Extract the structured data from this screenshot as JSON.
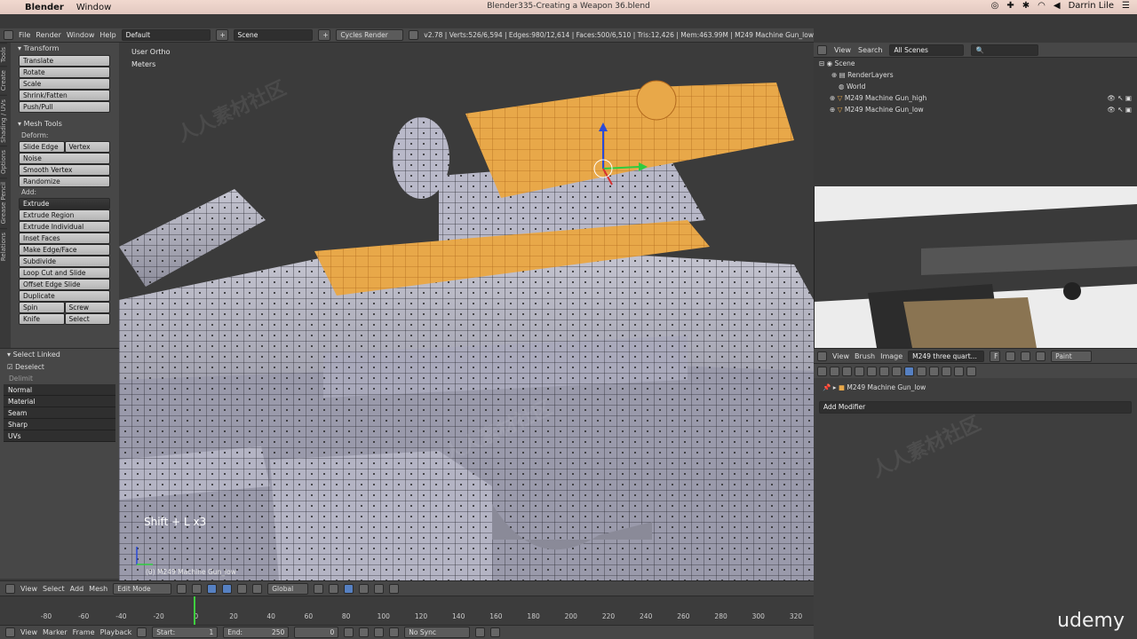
{
  "mac": {
    "apple": "",
    "app": "Blender",
    "window": "Window",
    "title": "Blender335-Creating a Weapon 36.blend",
    "user": "Darrin Lile"
  },
  "info": {
    "menus": [
      "File",
      "Render",
      "Window",
      "Help"
    ],
    "layout": "Default",
    "scene": "Scene",
    "engine": "Cycles Render",
    "stats": "v2.78 | Verts:526/6,594 | Edges:980/12,614 | Faces:500/6,510 | Tris:12,426 | Mem:463.99M | M249 Machine Gun_low"
  },
  "tabs": [
    "Tools",
    "Create",
    "Shading / UVs",
    "Options",
    "Grease Pencil",
    "Relations"
  ],
  "shelf": {
    "transform_title": "Transform",
    "transform": [
      "Translate",
      "Rotate",
      "Scale",
      "Shrink/Fatten",
      "Push/Pull"
    ],
    "mesh_title": "Mesh Tools",
    "deform_label": "Deform:",
    "slide_edge": "Slide Edge",
    "vertex": "Vertex",
    "deform": [
      "Noise",
      "Smooth Vertex",
      "Randomize"
    ],
    "add_label": "Add:",
    "extrude": "Extrude",
    "add": [
      "Extrude Region",
      "Extrude Individual",
      "Inset Faces",
      "Make Edge/Face",
      "Subdivide",
      "Loop Cut and Slide",
      "Offset Edge Slide",
      "Duplicate"
    ],
    "spin": "Spin",
    "screw": "Screw",
    "knife": "Knife",
    "select": "Select"
  },
  "redo": {
    "title": "Select Linked",
    "deselect": "Deselect",
    "delimit": "Delimit",
    "options": [
      "Normal",
      "Material",
      "Seam",
      "Sharp",
      "UVs"
    ]
  },
  "viewport": {
    "view": "User Ortho",
    "units": "Meters",
    "keys": "Shift + L x3",
    "object": "(0) M249 Machine Gun_low",
    "watermark": "人人素材社区"
  },
  "v3dh": {
    "menus": [
      "View",
      "Select",
      "Add",
      "Mesh"
    ],
    "mode": "Edit Mode",
    "orient": "Global"
  },
  "timeline": {
    "ticks": [
      "-80",
      "-60",
      "-40",
      "-20",
      "0",
      "20",
      "40",
      "60",
      "80",
      "100",
      "120",
      "140",
      "160",
      "180",
      "200",
      "220",
      "240",
      "260",
      "280",
      "300",
      "320"
    ],
    "current": 0
  },
  "tlh": {
    "menus": [
      "View",
      "Marker",
      "Frame",
      "Playback"
    ],
    "start_label": "Start:",
    "start": "1",
    "end_label": "End:",
    "end": "250",
    "frame": "0",
    "sync": "No Sync"
  },
  "outliner": {
    "menus": [
      "View",
      "Search"
    ],
    "filter": "All Scenes",
    "items": [
      "Scene",
      "RenderLayers",
      "World",
      "M249 Machine Gun_high",
      "M249 Machine Gun_low"
    ]
  },
  "imgh": {
    "menus": [
      "View",
      "Brush",
      "Image"
    ],
    "image": "M249 three quart...",
    "f": "F",
    "paint": "Paint"
  },
  "props": {
    "object": "M249 Machine Gun_low",
    "add_modifier": "Add Modifier"
  },
  "brand": {
    "udemy": "udemy"
  },
  "colors": {
    "accent": "#e8a849",
    "panel": "#474747",
    "selected": "#5680c2"
  }
}
